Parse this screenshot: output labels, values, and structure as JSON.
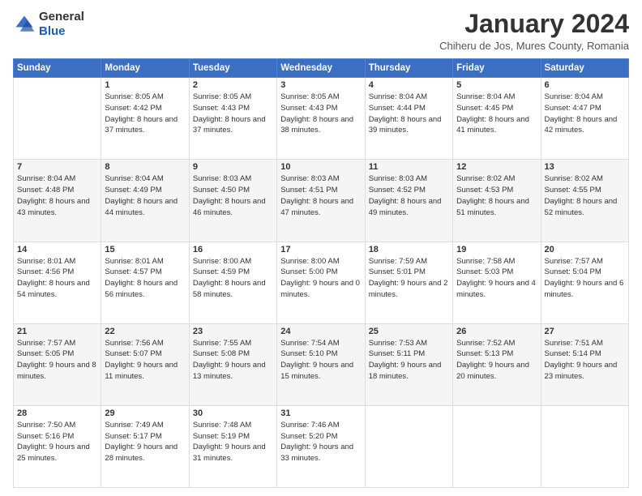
{
  "logo": {
    "general": "General",
    "blue": "Blue"
  },
  "header": {
    "month": "January 2024",
    "location": "Chiheru de Jos, Mures County, Romania"
  },
  "weekdays": [
    "Sunday",
    "Monday",
    "Tuesday",
    "Wednesday",
    "Thursday",
    "Friday",
    "Saturday"
  ],
  "weeks": [
    [
      {
        "day": "",
        "sunrise": "",
        "sunset": "",
        "daylight": ""
      },
      {
        "day": "1",
        "sunrise": "Sunrise: 8:05 AM",
        "sunset": "Sunset: 4:42 PM",
        "daylight": "Daylight: 8 hours and 37 minutes."
      },
      {
        "day": "2",
        "sunrise": "Sunrise: 8:05 AM",
        "sunset": "Sunset: 4:43 PM",
        "daylight": "Daylight: 8 hours and 37 minutes."
      },
      {
        "day": "3",
        "sunrise": "Sunrise: 8:05 AM",
        "sunset": "Sunset: 4:43 PM",
        "daylight": "Daylight: 8 hours and 38 minutes."
      },
      {
        "day": "4",
        "sunrise": "Sunrise: 8:04 AM",
        "sunset": "Sunset: 4:44 PM",
        "daylight": "Daylight: 8 hours and 39 minutes."
      },
      {
        "day": "5",
        "sunrise": "Sunrise: 8:04 AM",
        "sunset": "Sunset: 4:45 PM",
        "daylight": "Daylight: 8 hours and 41 minutes."
      },
      {
        "day": "6",
        "sunrise": "Sunrise: 8:04 AM",
        "sunset": "Sunset: 4:47 PM",
        "daylight": "Daylight: 8 hours and 42 minutes."
      }
    ],
    [
      {
        "day": "7",
        "sunrise": "Sunrise: 8:04 AM",
        "sunset": "Sunset: 4:48 PM",
        "daylight": "Daylight: 8 hours and 43 minutes."
      },
      {
        "day": "8",
        "sunrise": "Sunrise: 8:04 AM",
        "sunset": "Sunset: 4:49 PM",
        "daylight": "Daylight: 8 hours and 44 minutes."
      },
      {
        "day": "9",
        "sunrise": "Sunrise: 8:03 AM",
        "sunset": "Sunset: 4:50 PM",
        "daylight": "Daylight: 8 hours and 46 minutes."
      },
      {
        "day": "10",
        "sunrise": "Sunrise: 8:03 AM",
        "sunset": "Sunset: 4:51 PM",
        "daylight": "Daylight: 8 hours and 47 minutes."
      },
      {
        "day": "11",
        "sunrise": "Sunrise: 8:03 AM",
        "sunset": "Sunset: 4:52 PM",
        "daylight": "Daylight: 8 hours and 49 minutes."
      },
      {
        "day": "12",
        "sunrise": "Sunrise: 8:02 AM",
        "sunset": "Sunset: 4:53 PM",
        "daylight": "Daylight: 8 hours and 51 minutes."
      },
      {
        "day": "13",
        "sunrise": "Sunrise: 8:02 AM",
        "sunset": "Sunset: 4:55 PM",
        "daylight": "Daylight: 8 hours and 52 minutes."
      }
    ],
    [
      {
        "day": "14",
        "sunrise": "Sunrise: 8:01 AM",
        "sunset": "Sunset: 4:56 PM",
        "daylight": "Daylight: 8 hours and 54 minutes."
      },
      {
        "day": "15",
        "sunrise": "Sunrise: 8:01 AM",
        "sunset": "Sunset: 4:57 PM",
        "daylight": "Daylight: 8 hours and 56 minutes."
      },
      {
        "day": "16",
        "sunrise": "Sunrise: 8:00 AM",
        "sunset": "Sunset: 4:59 PM",
        "daylight": "Daylight: 8 hours and 58 minutes."
      },
      {
        "day": "17",
        "sunrise": "Sunrise: 8:00 AM",
        "sunset": "Sunset: 5:00 PM",
        "daylight": "Daylight: 9 hours and 0 minutes."
      },
      {
        "day": "18",
        "sunrise": "Sunrise: 7:59 AM",
        "sunset": "Sunset: 5:01 PM",
        "daylight": "Daylight: 9 hours and 2 minutes."
      },
      {
        "day": "19",
        "sunrise": "Sunrise: 7:58 AM",
        "sunset": "Sunset: 5:03 PM",
        "daylight": "Daylight: 9 hours and 4 minutes."
      },
      {
        "day": "20",
        "sunrise": "Sunrise: 7:57 AM",
        "sunset": "Sunset: 5:04 PM",
        "daylight": "Daylight: 9 hours and 6 minutes."
      }
    ],
    [
      {
        "day": "21",
        "sunrise": "Sunrise: 7:57 AM",
        "sunset": "Sunset: 5:05 PM",
        "daylight": "Daylight: 9 hours and 8 minutes."
      },
      {
        "day": "22",
        "sunrise": "Sunrise: 7:56 AM",
        "sunset": "Sunset: 5:07 PM",
        "daylight": "Daylight: 9 hours and 11 minutes."
      },
      {
        "day": "23",
        "sunrise": "Sunrise: 7:55 AM",
        "sunset": "Sunset: 5:08 PM",
        "daylight": "Daylight: 9 hours and 13 minutes."
      },
      {
        "day": "24",
        "sunrise": "Sunrise: 7:54 AM",
        "sunset": "Sunset: 5:10 PM",
        "daylight": "Daylight: 9 hours and 15 minutes."
      },
      {
        "day": "25",
        "sunrise": "Sunrise: 7:53 AM",
        "sunset": "Sunset: 5:11 PM",
        "daylight": "Daylight: 9 hours and 18 minutes."
      },
      {
        "day": "26",
        "sunrise": "Sunrise: 7:52 AM",
        "sunset": "Sunset: 5:13 PM",
        "daylight": "Daylight: 9 hours and 20 minutes."
      },
      {
        "day": "27",
        "sunrise": "Sunrise: 7:51 AM",
        "sunset": "Sunset: 5:14 PM",
        "daylight": "Daylight: 9 hours and 23 minutes."
      }
    ],
    [
      {
        "day": "28",
        "sunrise": "Sunrise: 7:50 AM",
        "sunset": "Sunset: 5:16 PM",
        "daylight": "Daylight: 9 hours and 25 minutes."
      },
      {
        "day": "29",
        "sunrise": "Sunrise: 7:49 AM",
        "sunset": "Sunset: 5:17 PM",
        "daylight": "Daylight: 9 hours and 28 minutes."
      },
      {
        "day": "30",
        "sunrise": "Sunrise: 7:48 AM",
        "sunset": "Sunset: 5:19 PM",
        "daylight": "Daylight: 9 hours and 31 minutes."
      },
      {
        "day": "31",
        "sunrise": "Sunrise: 7:46 AM",
        "sunset": "Sunset: 5:20 PM",
        "daylight": "Daylight: 9 hours and 33 minutes."
      },
      {
        "day": "",
        "sunrise": "",
        "sunset": "",
        "daylight": ""
      },
      {
        "day": "",
        "sunrise": "",
        "sunset": "",
        "daylight": ""
      },
      {
        "day": "",
        "sunrise": "",
        "sunset": "",
        "daylight": ""
      }
    ]
  ]
}
